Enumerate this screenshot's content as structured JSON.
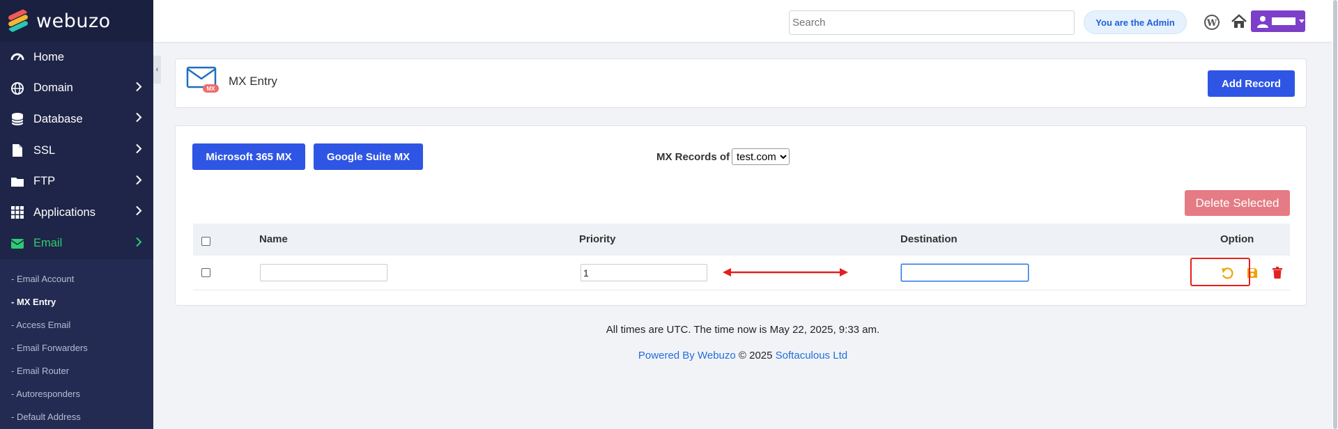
{
  "brand": {
    "name": "webuzo"
  },
  "sidebar": {
    "items": [
      {
        "label": "Home",
        "icon": "dashboard-icon"
      },
      {
        "label": "Domain",
        "icon": "globe-icon"
      },
      {
        "label": "Database",
        "icon": "database-icon"
      },
      {
        "label": "SSL",
        "icon": "file-icon"
      },
      {
        "label": "FTP",
        "icon": "folder-icon"
      },
      {
        "label": "Applications",
        "icon": "grid-icon"
      },
      {
        "label": "Email",
        "icon": "envelope-icon"
      }
    ],
    "email_submenu": [
      "- Email Account",
      "- MX Entry",
      "- Access Email",
      "- Email Forwarders",
      "- Email Router",
      "- Autoresponders",
      "- Default Address"
    ],
    "active_color": "#2ecc71"
  },
  "topbar": {
    "search_placeholder": "Search",
    "admin_label": "You are the Admin"
  },
  "header": {
    "title": "MX Entry",
    "icon_badge": "MX",
    "add_record_label": "Add Record"
  },
  "main": {
    "btn_365": "Microsoft 365 MX",
    "btn_gsuite": "Google Suite MX",
    "mx_records_label": "MX Records of",
    "domain_selected": "test.com",
    "delete_selected_label": "Delete Selected",
    "columns": {
      "name": "Name",
      "priority": "Priority",
      "destination": "Destination",
      "option": "Option"
    },
    "row": {
      "name_value": "",
      "priority_value": "1",
      "destination_value": ""
    }
  },
  "footer": {
    "time_text": "All times are UTC. The time now is May 22, 2025, 9:33 am.",
    "powered_by": "Powered By Webuzo",
    "copyright": " © 2025 ",
    "company": "Softaculous Ltd"
  },
  "colors": {
    "primary_button": "#2f55e4",
    "delete_button": "#e57b84",
    "revert_icon": "#f0a500",
    "trash_icon": "#e02424",
    "annotation_red": "#e51e1e"
  }
}
